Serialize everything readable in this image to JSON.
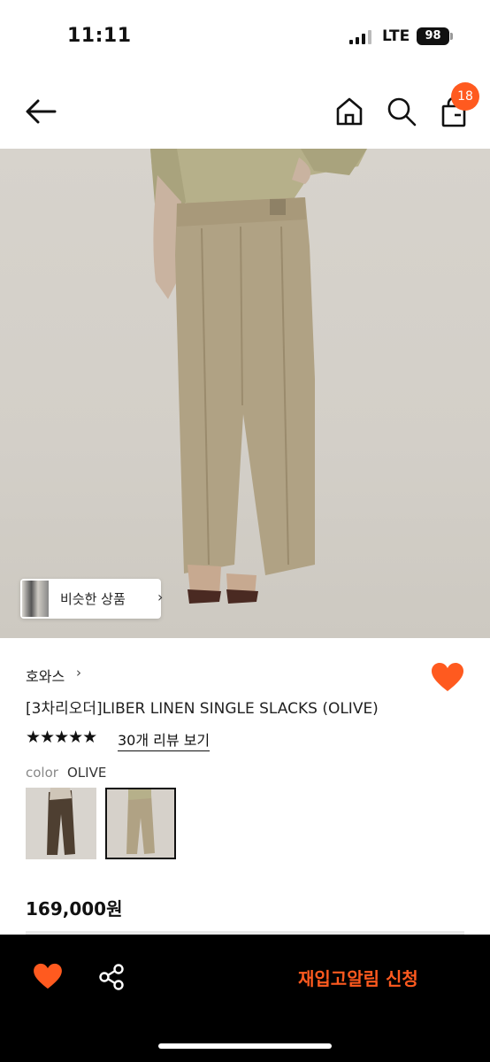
{
  "status_bar": {
    "time": "11:11",
    "carrier": "LTE",
    "battery": "98"
  },
  "header": {
    "cart_count": "18",
    "icons": [
      "back-arrow-icon",
      "home-icon",
      "search-icon",
      "shopping-bag-icon"
    ]
  },
  "product_image": {
    "similar_label": "비슷한 상품",
    "similar_chevron": "›"
  },
  "product": {
    "brand": "호와스",
    "brand_chevron": "›",
    "title": "[3차리오더]LIBER LINEN SINGLE SLACKS (OLIVE)",
    "stars": "★★★★★",
    "rating": 5,
    "review_link": "30개 리뷰 보기",
    "color_label": "color",
    "color_value": "OLIVE",
    "price": "169,000원"
  },
  "bottom_bar": {
    "restock_label": "재입고알림 신청"
  },
  "colors": {
    "accent": "#ff5a1f",
    "bottom_bar": "#000000"
  }
}
